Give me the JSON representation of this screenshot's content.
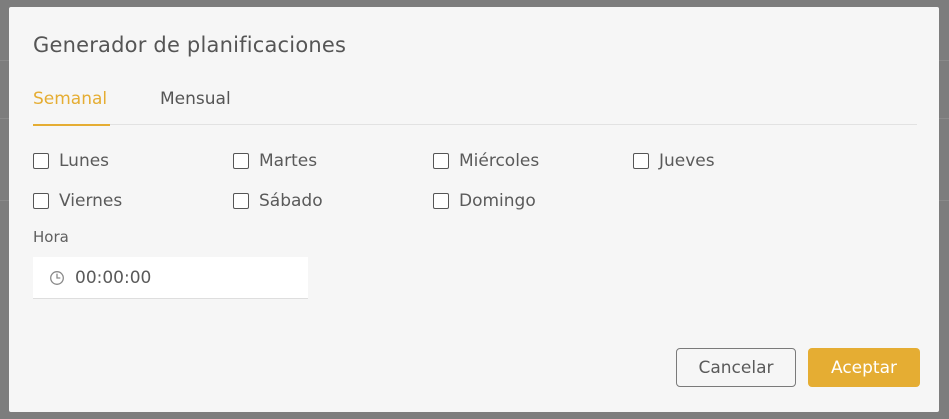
{
  "dialog": {
    "title": "Generador de planificaciones",
    "tabs": [
      {
        "label": "Semanal",
        "active": true
      },
      {
        "label": "Mensual",
        "active": false
      }
    ],
    "days": [
      {
        "label": "Lunes",
        "checked": false
      },
      {
        "label": "Martes",
        "checked": false
      },
      {
        "label": "Miércoles",
        "checked": false
      },
      {
        "label": "Jueves",
        "checked": false
      },
      {
        "label": "Viernes",
        "checked": false
      },
      {
        "label": "Sábado",
        "checked": false
      },
      {
        "label": "Domingo",
        "checked": false
      }
    ],
    "time": {
      "label": "Hora",
      "value": "00:00:00",
      "icon": "clock-icon"
    },
    "buttons": {
      "cancel": "Cancelar",
      "accept": "Aceptar"
    }
  },
  "colors": {
    "accent": "#e5ad33",
    "overlay": "#7d7d7d",
    "dialog_bg": "#f6f6f6",
    "text": "#555555"
  }
}
